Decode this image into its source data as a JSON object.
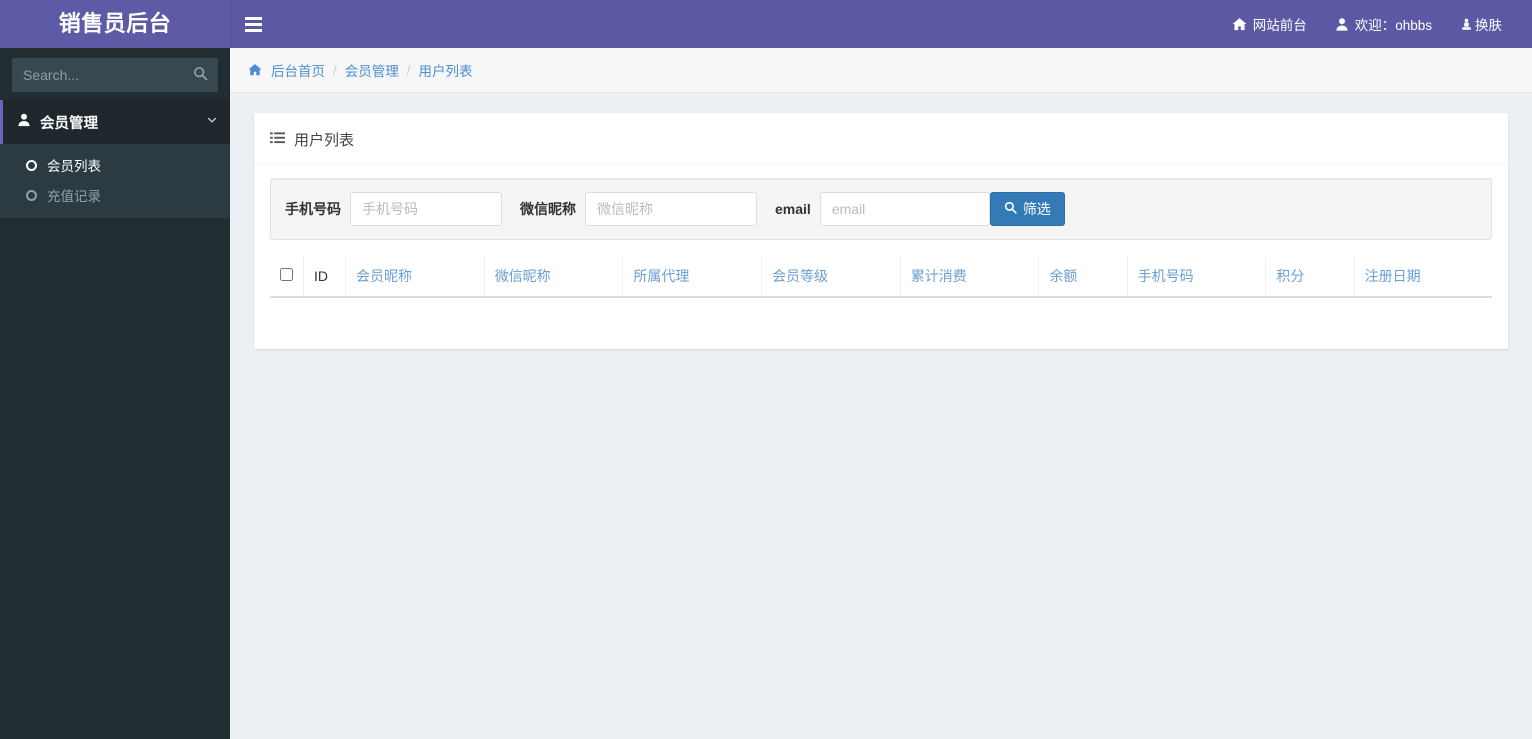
{
  "header": {
    "logo": "销售员后台",
    "toggle_icon": "hamburger-icon",
    "nav": [
      {
        "label": "网站前台",
        "icon": "home-icon"
      },
      {
        "label": "欢迎：ohbbs",
        "icon": "user-icon"
      },
      {
        "label": "换肤",
        "icon": "skin-icon"
      }
    ]
  },
  "sidebar": {
    "search": {
      "placeholder": "Search...",
      "value": "",
      "icon": "search-icon"
    },
    "menu": [
      {
        "label": "会员管理",
        "icon": "user-icon",
        "caret": "chevron-down-icon",
        "active": true,
        "children": [
          {
            "label": "会员列表",
            "active": true
          },
          {
            "label": "充值记录",
            "active": false
          }
        ]
      }
    ]
  },
  "breadcrumb": {
    "home_icon": "home-icon",
    "items": [
      {
        "label": "后台首页"
      },
      {
        "label": "会员管理"
      },
      {
        "label": "用户列表"
      }
    ],
    "separator": "/"
  },
  "box": {
    "title": "用户列表",
    "title_icon": "list-icon"
  },
  "filter": {
    "phone": {
      "label": "手机号码",
      "placeholder": "手机号码",
      "value": ""
    },
    "wechat": {
      "label": "微信昵称",
      "placeholder": "微信昵称",
      "value": ""
    },
    "email": {
      "label": "email",
      "placeholder": "email",
      "value": ""
    },
    "submit": {
      "label": "筛选",
      "icon": "search-icon"
    }
  },
  "table": {
    "select_all": "select-all-checkbox",
    "columns": [
      "ID",
      "会员昵称",
      "微信昵称",
      "所属代理",
      "会员等级",
      "累计消费",
      "余额",
      "手机号码",
      "积分",
      "注册日期"
    ],
    "rows": []
  },
  "colors": {
    "brand_purple": "#5d5ba6",
    "navbar_purple": "#5b59a4",
    "sidebar_dark": "#222d32",
    "sidebar_active": "#1e282c",
    "sidebar_submenu": "#2c3b41",
    "accent_left_border": "#6a67b8",
    "content_bg": "#ecf0f5",
    "link_blue": "#4b8fd0",
    "table_header_blue": "#6b9fd4",
    "button_blue": "#337ab7"
  }
}
